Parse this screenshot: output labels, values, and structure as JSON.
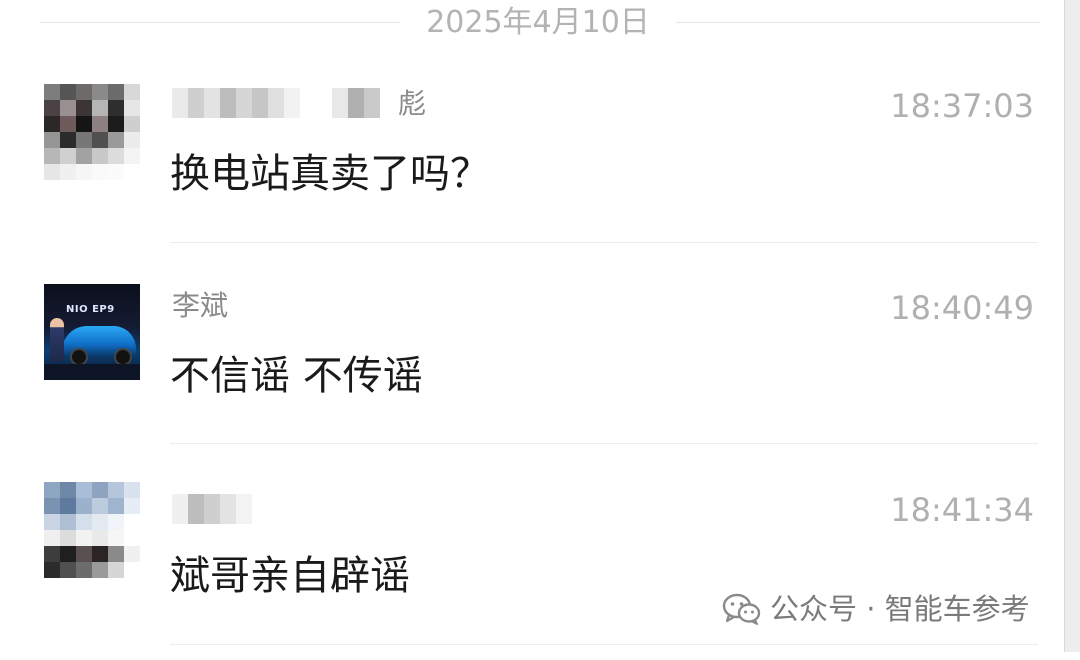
{
  "date_separator": "2025年4月10日",
  "messages": [
    {
      "sender_visible": "彪",
      "sender_redacted": true,
      "time": "18:37:03",
      "text": "换电站真卖了吗？"
    },
    {
      "sender_visible": "李斌",
      "sender_redacted": false,
      "time": "18:40:49",
      "text": "不信谣 不传谣",
      "avatar_brand": "NIO EP9"
    },
    {
      "sender_visible": "",
      "sender_redacted": true,
      "time": "18:41:34",
      "text": "斌哥亲自辟谣"
    }
  ],
  "watermark": {
    "icon": "wechat-icon",
    "text": "公众号 · 智能车参考"
  },
  "colors": {
    "timestamp": "#b0b0b0",
    "name": "#8a8a8a",
    "message_text": "#1a1a1a",
    "divider": "#ececec"
  }
}
